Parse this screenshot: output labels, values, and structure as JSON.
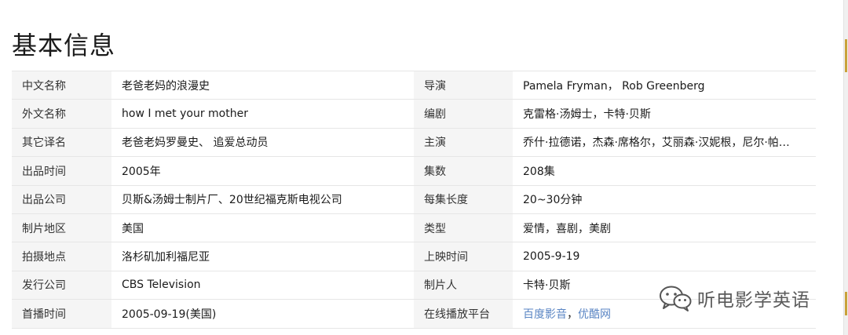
{
  "section": {
    "title": "基本信息"
  },
  "rows": [
    {
      "l1": "中文名称",
      "v1": "老爸老妈的浪漫史",
      "l2": "导演",
      "v2": "Pamela Fryman， Rob Greenberg"
    },
    {
      "l1": "外文名称",
      "v1": "how I met your mother",
      "l2": "编剧",
      "v2": "克雷格·汤姆士，卡特·贝斯"
    },
    {
      "l1": "其它译名",
      "v1": "老爸老妈罗曼史、 追爱总动员",
      "l2": "主演",
      "v2": "乔什·拉德诺，杰森·席格尔，艾丽森·汉妮根，尼尔·帕…"
    },
    {
      "l1": "出品时间",
      "v1": "2005年",
      "l2": "集数",
      "v2": "208集"
    },
    {
      "l1": "出品公司",
      "v1": "贝斯&汤姆士制片厂、20世纪福克斯电视公司",
      "l2": "每集长度",
      "v2": "20~30分钟"
    },
    {
      "l1": "制片地区",
      "v1": "美国",
      "l2": "类型",
      "v2": "爱情，喜剧，美剧"
    },
    {
      "l1": "拍摄地点",
      "v1": "洛杉矶加利福尼亚",
      "l2": "上映时间",
      "v2": "2005-9-19"
    },
    {
      "l1": "发行公司",
      "v1": "CBS Television",
      "l2": "制片人",
      "v2": "卡特·贝斯"
    },
    {
      "l1": "首播时间",
      "v1": "2005-09-19(美国)",
      "l2": "在线播放平台",
      "links": [
        "百度影音",
        "优酷网"
      ],
      "link_separator": "，"
    }
  ],
  "watermark": {
    "text": "听电影学英语",
    "icon": "wechat-icon"
  },
  "colors": {
    "label_bg": "#f5f5f5",
    "border": "#e6e6e6",
    "link": "#5b86c4"
  }
}
